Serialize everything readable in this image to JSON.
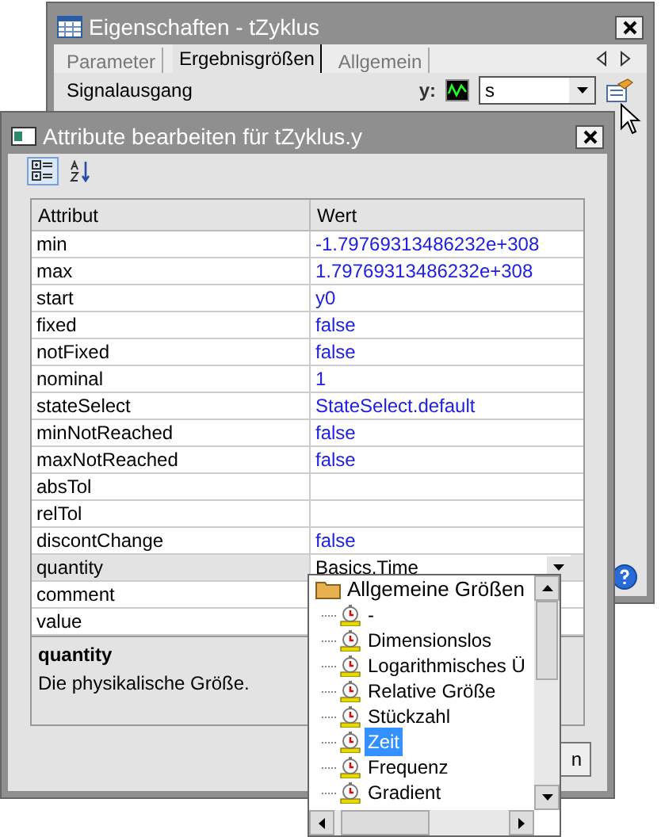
{
  "back_window": {
    "title": "Eigenschaften - tZyklus",
    "tabs": [
      {
        "label": "Parameter",
        "selected": false
      },
      {
        "label": "Ergebnisgrößen",
        "selected": true
      },
      {
        "label": "Allgemein",
        "selected": false
      }
    ],
    "section_label": "Signalausgang",
    "output_label": "y:",
    "output_value": "s"
  },
  "front_window": {
    "title": "Attribute bearbeiten für tZyklus.y",
    "toolbar": [
      {
        "kind": "categorized",
        "selected": true
      },
      {
        "kind": "alphabetical",
        "selected": false
      }
    ],
    "columns": [
      "Attribut",
      "Wert"
    ],
    "rows": [
      {
        "name": "min",
        "value": "-1.79769313486232e+308",
        "selected": false,
        "kind": "text"
      },
      {
        "name": "max",
        "value": "1.79769313486232e+308",
        "selected": false,
        "kind": "text"
      },
      {
        "name": "start",
        "value": "y0",
        "selected": false,
        "kind": "text"
      },
      {
        "name": "fixed",
        "value": "false",
        "selected": false,
        "kind": "text"
      },
      {
        "name": "notFixed",
        "value": "false",
        "selected": false,
        "kind": "text"
      },
      {
        "name": "nominal",
        "value": "1",
        "selected": false,
        "kind": "text"
      },
      {
        "name": "stateSelect",
        "value": "StateSelect.default",
        "selected": false,
        "kind": "text"
      },
      {
        "name": "minNotReached",
        "value": "false",
        "selected": false,
        "kind": "text"
      },
      {
        "name": "maxNotReached",
        "value": "false",
        "selected": false,
        "kind": "text"
      },
      {
        "name": "absTol",
        "value": "",
        "selected": false,
        "kind": "text"
      },
      {
        "name": "relTol",
        "value": "",
        "selected": false,
        "kind": "text"
      },
      {
        "name": "discontChange",
        "value": "false",
        "selected": false,
        "kind": "text"
      },
      {
        "name": "quantity",
        "value": "Basics.Time",
        "selected": true,
        "kind": "dropdown"
      },
      {
        "name": "comment",
        "value": "",
        "selected": false,
        "kind": "text"
      },
      {
        "name": "value",
        "value": "",
        "selected": false,
        "kind": "text"
      }
    ],
    "description": {
      "title": "quantity",
      "text": "Die physikalische Größe."
    },
    "button": "n"
  },
  "dropdown_tree": {
    "label": "Allgemeine Größen",
    "children": [
      {
        "label": "-",
        "selected": false
      },
      {
        "label": "Dimensionslos",
        "selected": false
      },
      {
        "label": "Logarithmisches Ü",
        "selected": false
      },
      {
        "label": "Relative Größe",
        "selected": false
      },
      {
        "label": "Stückzahl",
        "selected": false
      },
      {
        "label": "Zeit",
        "selected": true
      },
      {
        "label": "Frequenz",
        "selected": false
      },
      {
        "label": "Gradient",
        "selected": false
      }
    ]
  }
}
